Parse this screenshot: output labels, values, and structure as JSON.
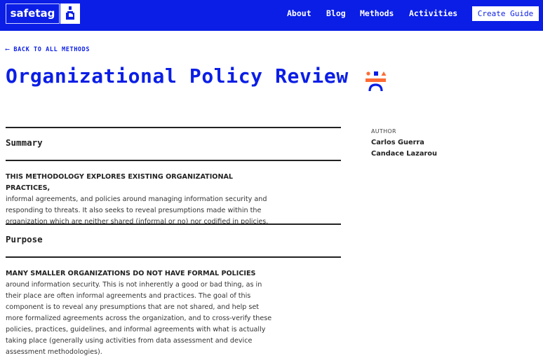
{
  "header": {
    "logo_text": "safetag",
    "logo_icon": "person-lock-icon",
    "nav": [
      {
        "label": "About"
      },
      {
        "label": "Blog"
      },
      {
        "label": "Methods"
      },
      {
        "label": "Activities"
      }
    ],
    "cta_label": "Create Guide"
  },
  "page": {
    "back_link": "⟵ BACK TO ALL METHODS",
    "title": "Organizational Policy Review",
    "title_icon": "method-face-icon"
  },
  "sections": [
    {
      "heading": "Summary",
      "lead": "THIS METHODOLOGY EXPLORES EXISTING ORGANIZATIONAL PRACTICES,",
      "body": "informal agreements, and policies around managing information security and responding to threats. It also seeks to reveal presumptions made within the organization which are neither shared (informal or no) nor codified in policies."
    },
    {
      "heading": "Purpose",
      "lead": "MANY SMALLER ORGANIZATIONS DO NOT HAVE FORMAL POLICIES",
      "body": "around information security. This is not inherently a good or bad thing, as in their place are often informal agreements and practices. The goal of this component is to reveal any presumptions that are not shared, and help set more formalized agreements across the organization, and to cross-verify these policies, practices, guidelines, and informal agreements with what is actually taking place (generally using activities from data assessment and device assessment methodologies)."
    }
  ],
  "sidebar": {
    "author_label": "AUTHOR",
    "authors": [
      "Carlos Guerra",
      "Candace Lazarou"
    ]
  },
  "colors": {
    "brand_blue": "#0a1ee6",
    "accent_orange": "#ff6b35",
    "text_dark": "#222222"
  }
}
